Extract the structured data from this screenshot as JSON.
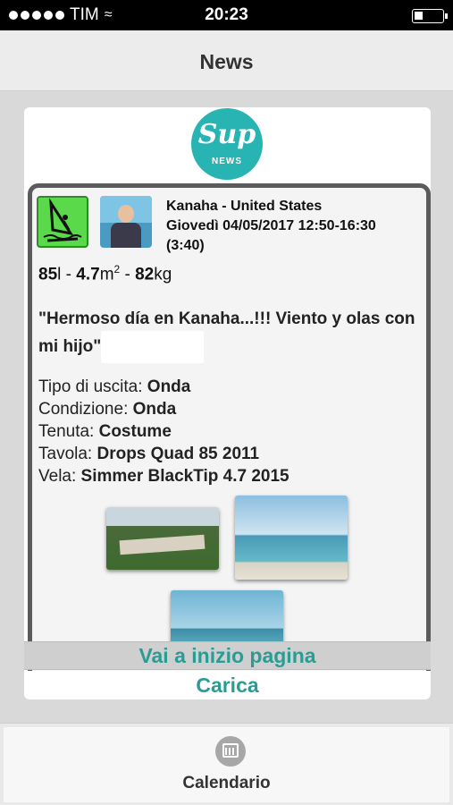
{
  "status_bar": {
    "carrier": "TIM",
    "time": "20:23"
  },
  "nav": {
    "title": "News"
  },
  "logo": {
    "top_text": "Sup",
    "bottom_text": "NEWS"
  },
  "post": {
    "location": "Kanaha - United States",
    "datetime": "Giovedì 04/05/2017 12:50-16:30",
    "duration": "(3:40)",
    "gear": {
      "board_volume": "85",
      "board_unit": "l",
      "sail_size": "4.7",
      "sail_unit": "m",
      "sail_exp": "2",
      "weight": "82",
      "weight_unit": "kg"
    },
    "quote": "\"Hermoso día en Kanaha...!!! Viento y olas con mi hijo\"",
    "details": [
      {
        "label": "Tipo di uscita: ",
        "value": "Onda"
      },
      {
        "label": "Condizione: ",
        "value": "Onda"
      },
      {
        "label": "Tenuta: ",
        "value": "Costume"
      },
      {
        "label": "Tavola: ",
        "value": "Drops Quad 85 2011"
      },
      {
        "label": "Vela: ",
        "value": "Simmer BlackTip 4.7 2015"
      }
    ]
  },
  "buttons": {
    "scroll_top": "Vai a inizio pagina",
    "load": "Carica"
  },
  "tabbar": {
    "calendar_label": "Calendario"
  },
  "colors": {
    "accent": "#2a9c94",
    "logo_bg": "#28b4b3"
  }
}
